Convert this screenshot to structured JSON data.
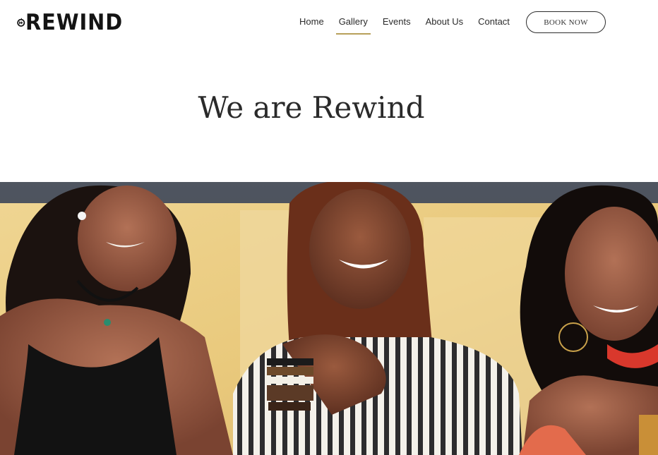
{
  "brand": {
    "logo_text": "REWIND",
    "logo_icon": "fast-forward-icon"
  },
  "nav": {
    "items": [
      {
        "label": "Home",
        "active": false
      },
      {
        "label": "Gallery",
        "active": true
      },
      {
        "label": "Events",
        "active": false
      },
      {
        "label": "About Us",
        "active": false
      },
      {
        "label": "Contact",
        "active": false
      }
    ],
    "book_button": "BOOK NOW"
  },
  "hero": {
    "headline": "We are Rewind"
  },
  "colors": {
    "active_underline": "#b7a05a",
    "text": "#2a2a2a",
    "background": "#ffffff"
  }
}
